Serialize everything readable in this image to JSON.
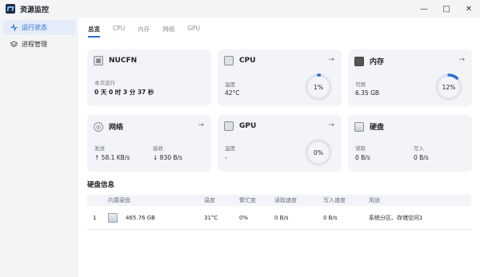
{
  "app": {
    "title": "资源监控"
  },
  "window": {
    "minimize": "—",
    "maximize": "□",
    "close": "✕"
  },
  "sidebar": {
    "items": [
      {
        "label": "运行状态",
        "icon": "activity-icon",
        "active": true
      },
      {
        "label": "进程管理",
        "icon": "layers-icon",
        "active": false
      }
    ]
  },
  "tabs": [
    {
      "label": "总览",
      "active": true
    },
    {
      "label": "CPU",
      "active": false
    },
    {
      "label": "内存",
      "active": false
    },
    {
      "label": "网络",
      "active": false
    },
    {
      "label": "GPU",
      "active": false
    }
  ],
  "cards": {
    "system": {
      "title": "NUCFN",
      "uptime_label": "本次运行",
      "uptime_value": "0 天 0 时 3 分 37 秒"
    },
    "cpu": {
      "title": "CPU",
      "temp_label": "温度",
      "temp_value": "42°C",
      "usage_text": "1%",
      "usage_pct": 1
    },
    "memory": {
      "title": "内存",
      "avail_label": "可用",
      "avail_value": "6.35 GB",
      "usage_text": "12%",
      "usage_pct": 12
    },
    "network": {
      "title": "网络",
      "send_label": "发送",
      "send_value": "↑ 58.1 KB/s",
      "recv_label": "接收",
      "recv_value": "↓ 830 B/s"
    },
    "gpu": {
      "title": "GPU",
      "temp_label": "温度",
      "temp_value": "-",
      "usage_text": "0%",
      "usage_pct": 0
    },
    "disk": {
      "title": "硬盘",
      "read_label": "读取",
      "read_value": "0 B/s",
      "write_label": "写入",
      "write_value": "0 B/s"
    }
  },
  "disk_info": {
    "title": "硬盘信息",
    "columns": [
      "",
      "内置硬盘",
      "温度",
      "繁忙度",
      "读取速度",
      "写入速度",
      "用途"
    ],
    "rows": [
      {
        "index": "1",
        "size": "465.76 GB",
        "temp": "31°C",
        "busy": "0%",
        "read": "0 B/s",
        "write": "0 B/s",
        "usage": "系统分区、存储空间1"
      }
    ]
  },
  "colors": {
    "accent": "#2b6dd6",
    "gauge_track": "#e1e5ea",
    "card_bg": "#f2f4f7"
  }
}
